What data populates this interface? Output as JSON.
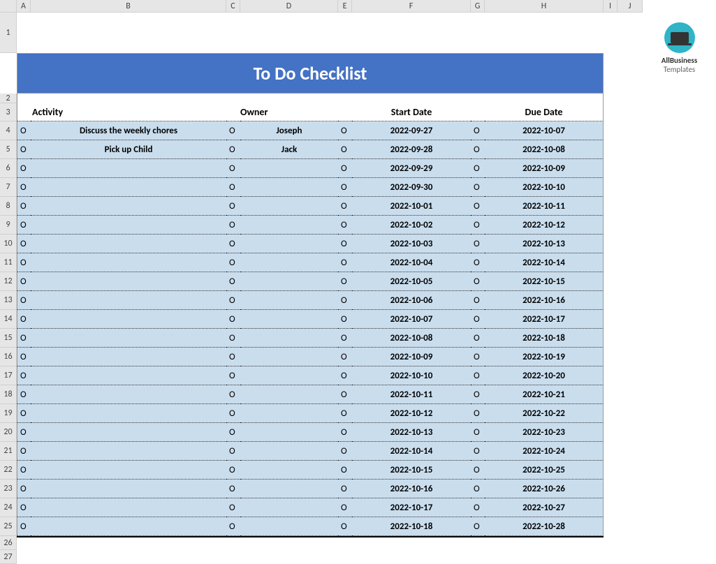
{
  "columns": [
    "A",
    "B",
    "C",
    "D",
    "E",
    "F",
    "G",
    "H",
    "I",
    "J"
  ],
  "title": "To Do Checklist",
  "headers": {
    "activity": "Activity",
    "owner": "Owner",
    "start": "Start Date",
    "due": "Due Date"
  },
  "marker": "O",
  "rows": [
    {
      "activity": "Discuss the weekly chores",
      "owner": "Joseph",
      "start": "2022-09-27",
      "due": "2022-10-07"
    },
    {
      "activity": "Pick up Child",
      "owner": "Jack",
      "start": "2022-09-28",
      "due": "2022-10-08"
    },
    {
      "activity": "",
      "owner": "",
      "start": "2022-09-29",
      "due": "2022-10-09"
    },
    {
      "activity": "",
      "owner": "",
      "start": "2022-09-30",
      "due": "2022-10-10"
    },
    {
      "activity": "",
      "owner": "",
      "start": "2022-10-01",
      "due": "2022-10-11"
    },
    {
      "activity": "",
      "owner": "",
      "start": "2022-10-02",
      "due": "2022-10-12"
    },
    {
      "activity": "",
      "owner": "",
      "start": "2022-10-03",
      "due": "2022-10-13"
    },
    {
      "activity": "",
      "owner": "",
      "start": "2022-10-04",
      "due": "2022-10-14"
    },
    {
      "activity": "",
      "owner": "",
      "start": "2022-10-05",
      "due": "2022-10-15"
    },
    {
      "activity": "",
      "owner": "",
      "start": "2022-10-06",
      "due": "2022-10-16"
    },
    {
      "activity": "",
      "owner": "",
      "start": "2022-10-07",
      "due": "2022-10-17"
    },
    {
      "activity": "",
      "owner": "",
      "start": "2022-10-08",
      "due": "2022-10-18"
    },
    {
      "activity": "",
      "owner": "",
      "start": "2022-10-09",
      "due": "2022-10-19"
    },
    {
      "activity": "",
      "owner": "",
      "start": "2022-10-10",
      "due": "2022-10-20"
    },
    {
      "activity": "",
      "owner": "",
      "start": "2022-10-11",
      "due": "2022-10-21"
    },
    {
      "activity": "",
      "owner": "",
      "start": "2022-10-12",
      "due": "2022-10-22"
    },
    {
      "activity": "",
      "owner": "",
      "start": "2022-10-13",
      "due": "2022-10-23"
    },
    {
      "activity": "",
      "owner": "",
      "start": "2022-10-14",
      "due": "2022-10-24"
    },
    {
      "activity": "",
      "owner": "",
      "start": "2022-10-15",
      "due": "2022-10-25"
    },
    {
      "activity": "",
      "owner": "",
      "start": "2022-10-16",
      "due": "2022-10-26"
    },
    {
      "activity": "",
      "owner": "",
      "start": "2022-10-17",
      "due": "2022-10-27"
    },
    {
      "activity": "",
      "owner": "",
      "start": "2022-10-18",
      "due": "2022-10-28"
    }
  ],
  "logo": {
    "line1": "AllBusiness",
    "line2": "Templates"
  },
  "row_count_visible": 27
}
